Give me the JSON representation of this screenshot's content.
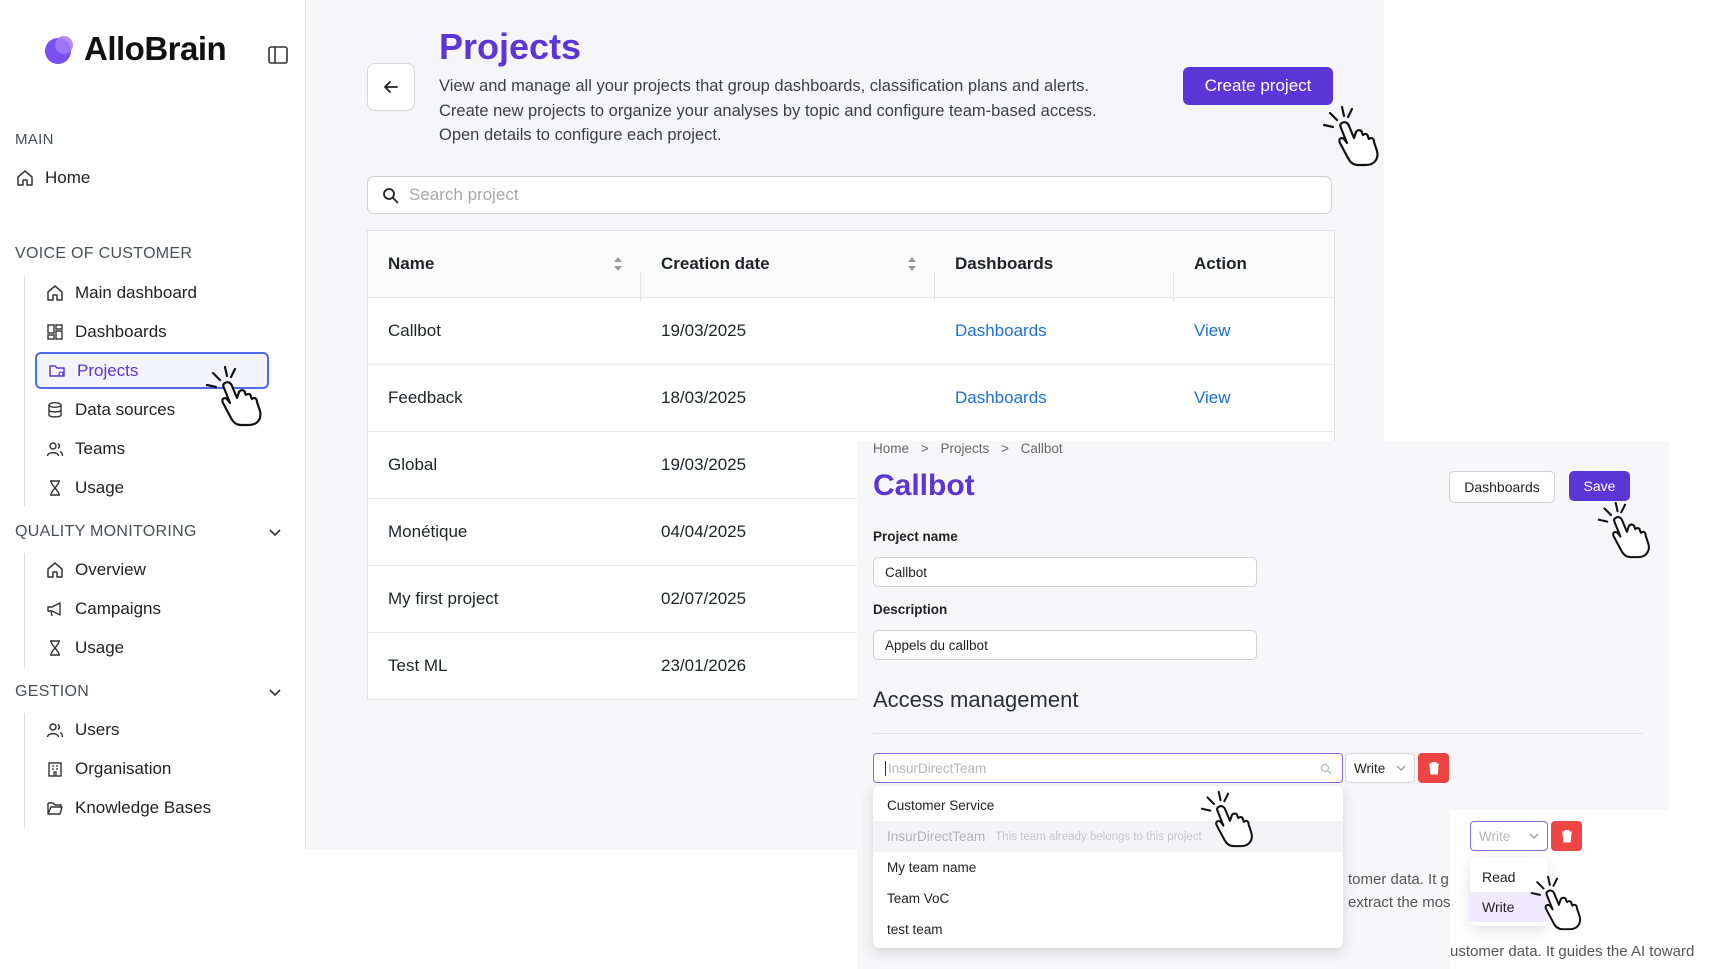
{
  "sidebar": {
    "brand": "AlloBrain",
    "sections": {
      "main": "MAIN",
      "voice": "VOICE OF CUSTOMER",
      "quality": "QUALITY MONITORING",
      "gestion": "GESTION"
    },
    "home": "Home",
    "voice_items": [
      "Main dashboard",
      "Dashboards",
      "Projects",
      "Data sources",
      "Teams",
      "Usage"
    ],
    "quality_items": [
      "Overview",
      "Campaigns",
      "Usage"
    ],
    "gestion_items": [
      "Users",
      "Organisation",
      "Knowledge Bases"
    ]
  },
  "projects": {
    "title": "Projects",
    "description": [
      "View and manage all your projects that group dashboards, classification plans and alerts.",
      "Create new projects to organize your analyses by topic and configure team-based access.",
      "Open details to configure each project."
    ],
    "create_label": "Create project",
    "search_placeholder": "Search project",
    "columns": [
      "Name",
      "Creation date",
      "Dashboards",
      "Action"
    ],
    "rows": [
      {
        "name": "Callbot",
        "date": "19/03/2025",
        "dashboards": "Dashboards",
        "action": "View"
      },
      {
        "name": "Feedback",
        "date": "18/03/2025",
        "dashboards": "Dashboards",
        "action": "View"
      },
      {
        "name": "Global",
        "date": "19/03/2025"
      },
      {
        "name": "Monétique",
        "date": "04/04/2025"
      },
      {
        "name": "My first project",
        "date": "02/07/2025"
      },
      {
        "name": "Test ML",
        "date": "23/01/2026"
      }
    ]
  },
  "detail": {
    "breadcrumb": [
      "Home",
      "Projects",
      "Callbot"
    ],
    "breadcrumb_sep": ">",
    "title": "Callbot",
    "dashboards_btn": "Dashboards",
    "save_btn": "Save",
    "project_name_label": "Project name",
    "project_name_value": "Callbot",
    "description_label": "Description",
    "description_value": "Appels du callbot",
    "access_title": "Access management",
    "team_placeholder": "InsurDirectTeam",
    "permission": "Write",
    "team_options": [
      {
        "label": "Customer Service"
      },
      {
        "label": "InsurDirectTeam",
        "hint": "This team already belongs to this project",
        "disabled": true
      },
      {
        "label": "My team name"
      },
      {
        "label": "Team VoC"
      },
      {
        "label": "test team"
      }
    ],
    "permission_options": [
      "Read",
      "Write"
    ],
    "text_fragments": [
      "tomer data. It g",
      "extract the mos",
      "ustomer data. It guides the AI toward"
    ]
  }
}
